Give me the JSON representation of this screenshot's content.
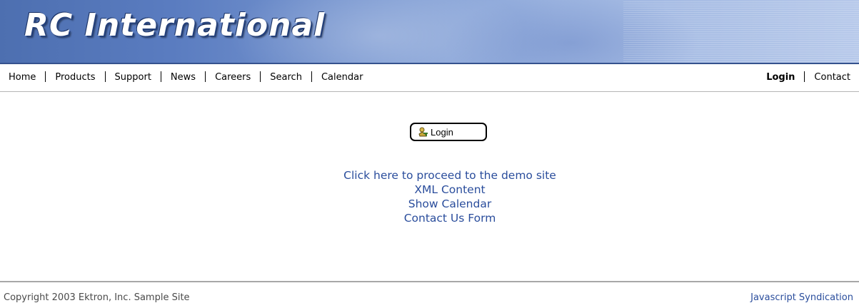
{
  "banner": {
    "logo_text": "RC International"
  },
  "nav": {
    "left_items": [
      "Home",
      "Products",
      "Support",
      "News",
      "Careers",
      "Search",
      "Calendar"
    ],
    "login_label": "Login",
    "contact_label": "Contact"
  },
  "login_button": {
    "label": "Login",
    "icon": "key-icon"
  },
  "links": {
    "demo": "Click here to proceed to the demo site",
    "xml": "XML Content",
    "calendar": "Show Calendar",
    "contact_form": "Contact Us Form"
  },
  "footer": {
    "copyright": "Copyright 2003 Ektron, Inc. Sample Site",
    "syndication": "Javascript Syndication"
  },
  "colors": {
    "link": "#2a4d9c",
    "banner": "#5a7cc0"
  }
}
